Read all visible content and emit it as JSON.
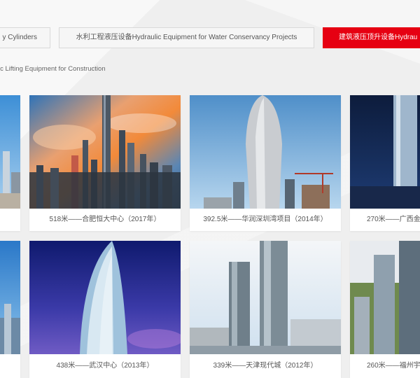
{
  "tabs": [
    {
      "label": "y Cylinders",
      "active": false
    },
    {
      "label": "水利工程液压设备Hydraulic Equipment for Water Conservancy Projects",
      "active": false
    },
    {
      "label": "建筑液压顶升设备Hydrau",
      "active": true
    }
  ],
  "subtitle": "ic Lifting Equipment for Construction",
  "colors": {
    "accent": "#e60012",
    "background": "#efefef"
  },
  "projects": [
    {
      "caption": ""
    },
    {
      "caption": "518米——合肥恒大中心（2017年）"
    },
    {
      "caption": "392.5米——华润深圳湾项目（2014年）"
    },
    {
      "caption": "270米——广西金"
    },
    {
      "caption": ""
    },
    {
      "caption": "438米——武汉中心（2013年）"
    },
    {
      "caption": "339米——天津现代城（2012年）"
    },
    {
      "caption": "260米——福州宇"
    }
  ]
}
